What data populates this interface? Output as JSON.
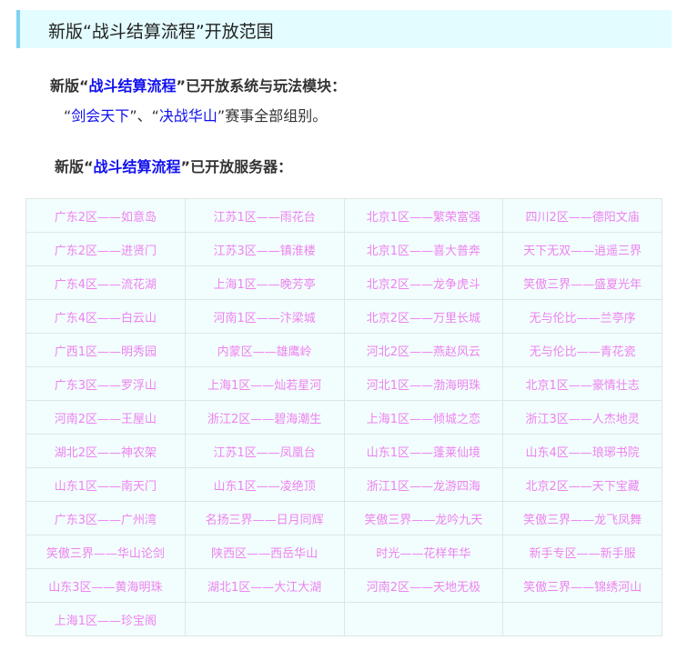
{
  "header": {
    "title": "新版“战斗结算流程”开放范围"
  },
  "modules": {
    "prefix": "新版“",
    "highlight": "战斗结算流程",
    "suffix": "”已开放系统与玩法模块：",
    "line2_q1": "“",
    "line2_item1": "剑会天下",
    "line2_q2": "”、“",
    "line2_item2": "决战华山",
    "line2_rest": "”赛事全部组别。"
  },
  "servers": {
    "prefix": "新版“",
    "highlight": "战斗结算流程",
    "suffix": "”已开放服务器：",
    "list": [
      "广东2区——如意岛",
      "江苏1区——雨花台",
      "北京1区——繁荣富强",
      "四川2区——德阳文庙",
      "广东2区——进贤门",
      "江苏3区——镇淮楼",
      "北京1区——喜大普奔",
      "天下无双——逍遥三界",
      "广东4区——流花湖",
      "上海1区——晚芳亭",
      "北京2区——龙争虎斗",
      "笑傲三界——盛夏光年",
      "广东4区——白云山",
      "河南1区——汴梁城",
      "北京2区——万里长城",
      "无与伦比——兰亭序",
      "广西1区——明秀园",
      "内蒙区——雄鹰岭",
      "河北2区——燕赵风云",
      "无与伦比——青花瓷",
      "广东3区——罗浮山",
      "上海1区——灿若星河",
      "河北1区——渤海明珠",
      "北京1区——豪情壮志",
      "河南2区——王屋山",
      "浙江2区——碧海潮生",
      "上海1区——倾城之恋",
      "浙江3区——人杰地灵",
      "湖北2区——神农架",
      "江苏1区——凤凰台",
      "山东1区——蓬莱仙境",
      "山东4区——琅琊书院",
      "山东1区——南天门",
      "山东1区——凌绝顶",
      "浙江1区——龙游四海",
      "北京2区——天下宝藏",
      "广东3区——广州湾",
      "名扬三界——日月同辉",
      "笑傲三界——龙吟九天",
      "笑傲三界——龙飞凤舞",
      "笑傲三界——华山论剑",
      "陕西区——西岳华山",
      "时光——花样年华",
      "新手专区——新手服",
      "山东3区——黄海明珠",
      "湖北1区——大江大湖",
      "河南2区——天地无极",
      "笑傲三界——锦绣河山",
      "上海1区——珍宝阁"
    ]
  },
  "colors": {
    "highlight": "#1010ee",
    "server_text": "#ee82ee",
    "header_bg": "#e3fcff",
    "header_border": "#7fd3f2"
  }
}
